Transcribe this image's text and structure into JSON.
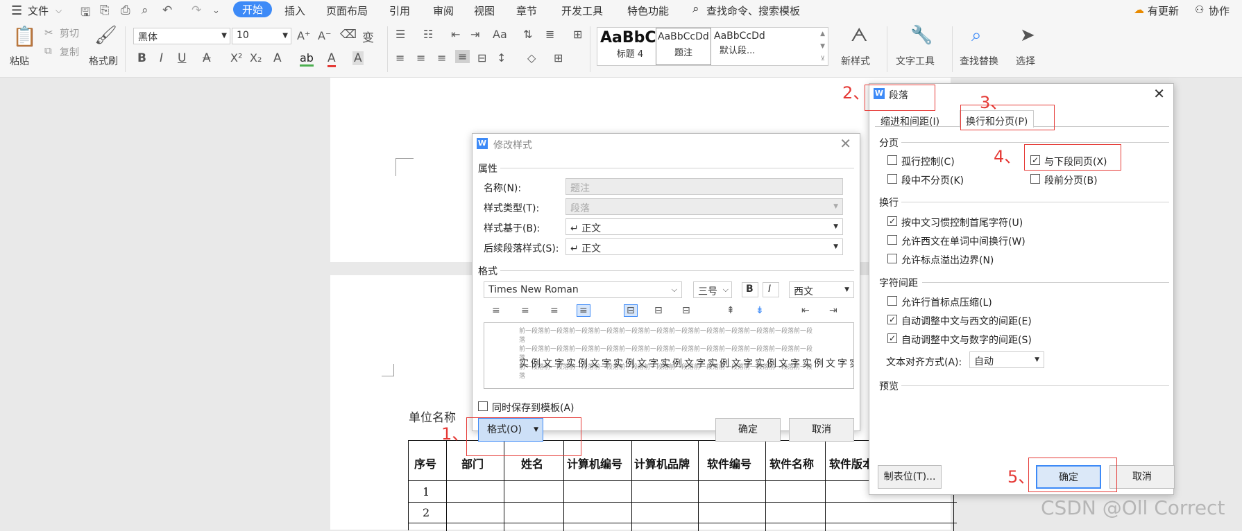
{
  "menubar": {
    "file": "文件",
    "tabs": [
      "开始",
      "插入",
      "页面布局",
      "引用",
      "审阅",
      "视图",
      "章节",
      "开发工具",
      "特色功能"
    ],
    "search": "查找命令、搜索模板",
    "update": "有更新",
    "collab": "协作"
  },
  "ribbon": {
    "paste": "粘贴",
    "cut": "剪切",
    "copy": "复制",
    "format_painter": "格式刷",
    "font_name": "黑体",
    "font_size": "10",
    "styles": [
      {
        "preview": "AaBbC",
        "name": "标题 4"
      },
      {
        "preview": "AaBbCcDd",
        "name": "题注"
      },
      {
        "preview": "AaBbCcDd",
        "name": "默认段..."
      }
    ],
    "new_style": "新样式",
    "text_tools": "文字工具",
    "find_replace": "查找替换",
    "select": "选择"
  },
  "document": {
    "unit_label": "单位名称",
    "headers": [
      "序号",
      "部门",
      "姓名",
      "计算机编号",
      "计算机品牌",
      "软件编号",
      "软件名称",
      "软件版本"
    ],
    "rows": [
      "1",
      "2"
    ]
  },
  "modify_dialog": {
    "title": "修改样式",
    "attributes": "属性",
    "name_label": "名称(N):",
    "name_value": "题注",
    "type_label": "样式类型(T):",
    "type_value": "段落",
    "based_label": "样式基于(B):",
    "based_value": "↵ 正文",
    "next_label": "后续段落样式(S):",
    "next_value": "↵ 正文",
    "format_group": "格式",
    "font": "Times New Roman",
    "size": "三号",
    "bold": "B",
    "italic": "I",
    "script": "西文",
    "preview_prev": "前一段落前一段落前一段落前一段落前一段落前一段落前一段落前一段落前一段落前一段落前一段落前一段落",
    "preview_sample": "实例文字实例文字实例文字实例文字实例文字实例文字实例文字实",
    "save_template": "同时保存到模板(A)",
    "format_btn": "格式(O)",
    "ok": "确定",
    "cancel": "取消"
  },
  "para_dialog": {
    "title": "段落",
    "tab_indent": "缩进和间距(I)",
    "tab_break": "换行和分页(P)",
    "pagination": "分页",
    "widow": "孤行控制(C)",
    "keep_next": "与下段同页(X)",
    "keep_lines": "段中不分页(K)",
    "page_before": "段前分页(B)",
    "linebreak": "换行",
    "cjk_rule": "按中文习惯控制首尾字符(U)",
    "word_wrap": "允许西文在单词中间换行(W)",
    "punct_overflow": "允许标点溢出边界(N)",
    "char_spacing": "字符间距",
    "compress": "允许行首标点压缩(L)",
    "auto_west": "自动调整中文与西文的间距(E)",
    "auto_num": "自动调整中文与数字的间距(S)",
    "align_label": "文本对齐方式(A):",
    "align_value": "自动",
    "preview": "预览",
    "tabs_btn": "制表位(T)...",
    "ok": "确定",
    "cancel": "取消"
  },
  "annotations": [
    "1、",
    "2、",
    "3、",
    "4、",
    "5、"
  ],
  "watermark": "CSDN @Oll Correct"
}
